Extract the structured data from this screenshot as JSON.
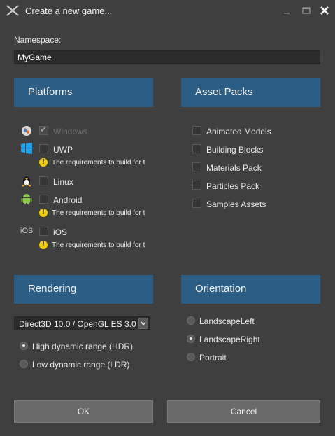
{
  "window": {
    "title": "Create a new game...",
    "icons": {
      "app": "stride-x-icon",
      "minimize": "minimize-icon",
      "maximize": "maximize-icon",
      "close": "close-icon"
    }
  },
  "namespace": {
    "label": "Namespace:",
    "value": "MyGame"
  },
  "platforms": {
    "header": "Platforms",
    "items": [
      {
        "label": "Windows",
        "checked": true,
        "disabled": true,
        "icon": "windows-globe-icon"
      },
      {
        "label": "UWP",
        "checked": false,
        "icon": "windows-logo-icon",
        "warning": "The requirements to build for t"
      },
      {
        "label": "Linux",
        "checked": false,
        "icon": "linux-penguin-icon"
      },
      {
        "label": "Android",
        "checked": false,
        "icon": "android-robot-icon",
        "warning": "The requirements to build for t"
      },
      {
        "label": "iOS",
        "checked": false,
        "icon_text": "iOS",
        "warning": "The requirements to build for t"
      }
    ]
  },
  "asset_packs": {
    "header": "Asset Packs",
    "items": [
      {
        "label": "Animated Models",
        "checked": false
      },
      {
        "label": "Building Blocks",
        "checked": false
      },
      {
        "label": "Materials Pack",
        "checked": false
      },
      {
        "label": "Particles Pack",
        "checked": false
      },
      {
        "label": "Samples Assets",
        "checked": false
      }
    ]
  },
  "rendering": {
    "header": "Rendering",
    "graphics_api": "Direct3D 10.0 / OpenGL ES 3.0",
    "options": [
      {
        "label": "High dynamic range (HDR)",
        "selected": true
      },
      {
        "label": "Low dynamic range (LDR)",
        "selected": false
      }
    ]
  },
  "orientation": {
    "header": "Orientation",
    "options": [
      {
        "label": "LandscapeLeft",
        "selected": false
      },
      {
        "label": "LandscapeRight",
        "selected": true
      },
      {
        "label": "Portrait",
        "selected": false
      }
    ]
  },
  "buttons": {
    "ok": "OK",
    "cancel": "Cancel"
  },
  "colors": {
    "background": "#3f3f3f",
    "section_header": "#2c5d85",
    "warning": "#f0d000",
    "button": "#6a6a6a"
  }
}
